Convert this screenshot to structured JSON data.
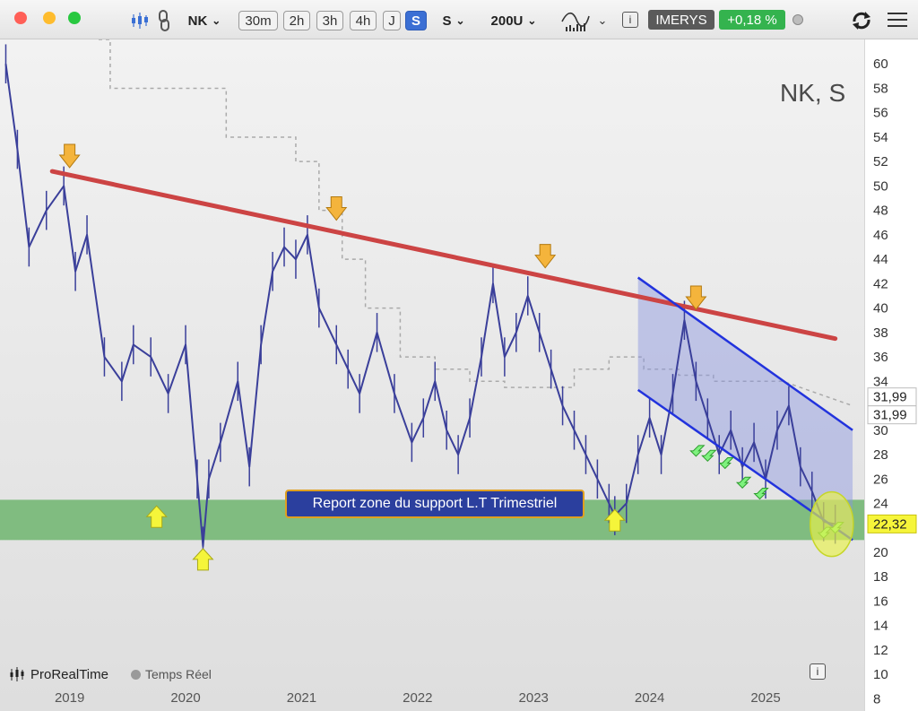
{
  "toolbar": {
    "symbol": "NK",
    "timeframes": [
      "30m",
      "2h",
      "3h",
      "4h",
      "J",
      "S"
    ],
    "selected_timeframe": "S",
    "period_select": "S",
    "bars_select": "200U",
    "info_label": "i",
    "instrument_name": "IMERYS",
    "change": "+0,18 %",
    "colors": {
      "selected": "#3b6fd4",
      "positive": "#2fb34a",
      "instrument": "#555555"
    },
    "icons": [
      "candlestick-icon",
      "link-icon",
      "chart-style-icon",
      "sync-icon",
      "menu-icon"
    ]
  },
  "chart": {
    "title": "NK, S",
    "annotation": "Report zone du support  L.T Trimestriel",
    "footer_brand": "ProRealTime",
    "footer_mode": "Temps Réel",
    "info_label": "i",
    "colors": {
      "price_line": "#3a3f9a",
      "resistance": "#cc4444",
      "channel": "#2233dd",
      "channel_fill": "#8a95e0",
      "support_zone": "#6fb56f",
      "moving_average": "#aaaaaa",
      "down_arrow": "#f4b43c",
      "up_arrow": "#f5f53a",
      "small_arrow": "#7ef27e"
    }
  },
  "chart_data": {
    "type": "line",
    "x_ticks": [
      "2019",
      "2020",
      "2021",
      "2022",
      "2023",
      "2024",
      "2025"
    ],
    "y_ticks": [
      8,
      10,
      12,
      14,
      16,
      18,
      20,
      22,
      24,
      26,
      28,
      30,
      32,
      34,
      36,
      38,
      40,
      42,
      44,
      46,
      48,
      50,
      52,
      54,
      56,
      58,
      60
    ],
    "ylim": [
      7,
      62
    ],
    "x_range": [
      2018.45,
      2025.9
    ],
    "price_labels": [
      {
        "value": 31.99,
        "label": "31,99"
      },
      {
        "value": 31.99,
        "label": "31,99"
      },
      {
        "value": 22.32,
        "label": "22,32"
      }
    ],
    "series_price": {
      "x": [
        2018.5,
        2018.6,
        2018.7,
        2018.85,
        2019.0,
        2019.1,
        2019.2,
        2019.35,
        2019.5,
        2019.6,
        2019.75,
        2019.9,
        2020.05,
        2020.15,
        2020.2,
        2020.25,
        2020.35,
        2020.5,
        2020.6,
        2020.7,
        2020.8,
        2020.9,
        2021.0,
        2021.1,
        2021.2,
        2021.35,
        2021.45,
        2021.55,
        2021.7,
        2021.85,
        2022.0,
        2022.1,
        2022.2,
        2022.3,
        2022.4,
        2022.5,
        2022.6,
        2022.7,
        2022.8,
        2022.9,
        2023.0,
        2023.1,
        2023.2,
        2023.3,
        2023.4,
        2023.5,
        2023.6,
        2023.7,
        2023.75,
        2023.85,
        2023.95,
        2024.05,
        2024.15,
        2024.25,
        2024.35,
        2024.45,
        2024.55,
        2024.65,
        2024.75,
        2024.85,
        2024.95,
        2025.05,
        2025.15,
        2025.25,
        2025.35,
        2025.45,
        2025.55,
        2025.65
      ],
      "y": [
        60,
        53,
        45,
        48,
        50,
        43,
        46,
        36,
        34,
        37,
        36,
        33,
        37,
        26,
        20.5,
        26,
        29,
        34,
        27,
        37,
        43,
        45,
        44,
        46,
        40,
        37,
        35,
        33,
        38,
        33,
        29,
        31,
        34,
        30,
        28,
        31,
        36,
        42,
        36,
        38,
        41,
        38,
        35,
        32,
        30,
        28,
        26,
        24,
        23,
        24,
        28,
        31,
        28,
        33,
        39,
        34,
        31,
        28,
        30,
        27,
        29,
        26,
        30,
        32,
        27,
        25,
        22.5,
        22.3
      ]
    },
    "series_moving_average": {
      "x": [
        2019.3,
        2019.4,
        2019.4,
        2019.6,
        2019.6,
        2019.8,
        2019.8,
        2020.0,
        2020.0,
        2020.4,
        2020.4,
        2020.6,
        2020.6,
        2020.8,
        2020.8,
        2021.0,
        2021.0,
        2021.2,
        2021.2,
        2021.4,
        2021.4,
        2021.6,
        2021.6,
        2021.9,
        2021.9,
        2022.2,
        2022.2,
        2022.5,
        2022.5,
        2022.8,
        2022.8,
        2023.1,
        2023.1,
        2023.4,
        2023.4,
        2023.7,
        2023.7,
        2024.0,
        2024.0,
        2024.3,
        2024.3,
        2024.6,
        2024.6,
        2025.2,
        2025.5,
        2025.8
      ],
      "y": [
        62,
        62,
        58,
        58,
        58,
        58,
        58,
        58,
        58,
        58,
        54,
        54,
        54,
        54,
        54,
        54,
        52,
        52,
        48,
        48,
        44,
        44,
        40,
        40,
        36,
        36,
        35,
        35,
        34,
        34,
        33.5,
        33.5,
        33.5,
        33.5,
        35,
        35,
        36,
        36,
        35,
        35,
        34.5,
        34.5,
        34,
        34,
        33,
        32
      ]
    },
    "resistance_line": {
      "x": [
        2018.9,
        2025.65
      ],
      "y": [
        51.2,
        37.5
      ]
    },
    "channel_upper": {
      "x": [
        2023.95,
        2025.8
      ],
      "y": [
        42.5,
        30
      ]
    },
    "channel_lower": {
      "x": [
        2023.95,
        2025.8
      ],
      "y": [
        33.3,
        21
      ]
    },
    "support_zone": {
      "y": [
        21,
        24.3
      ]
    },
    "grid": false,
    "legend": "none"
  }
}
